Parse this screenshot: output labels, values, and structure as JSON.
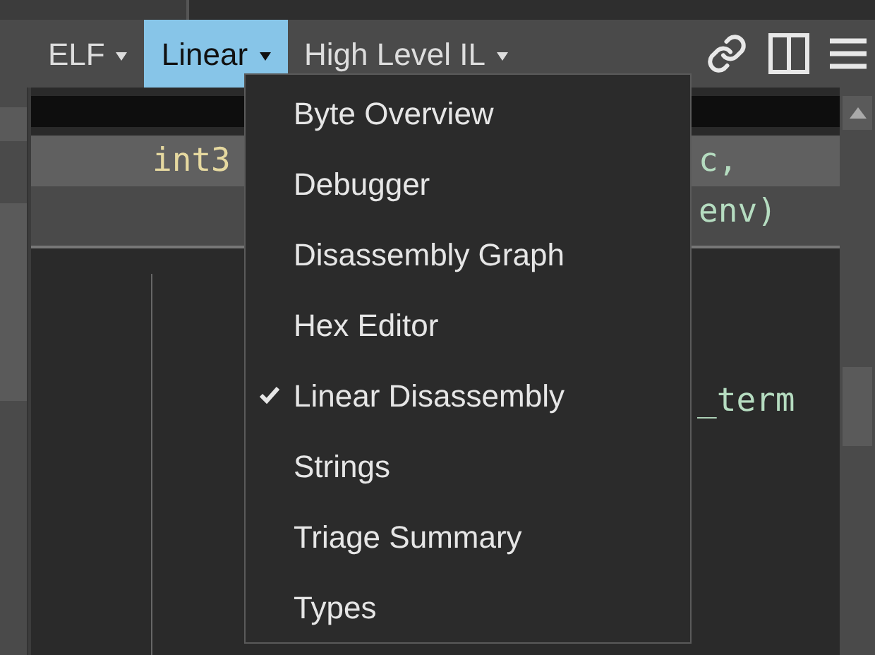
{
  "toolbar": {
    "tabs": [
      {
        "label": "ELF",
        "selected": false
      },
      {
        "label": "Linear",
        "selected": true
      },
      {
        "label": "High Level IL",
        "selected": false
      }
    ]
  },
  "code": {
    "header_lines": [
      {
        "left": "int3",
        "right": "c,",
        "highlighted": true
      },
      {
        "right": "env)",
        "highlighted": false
      }
    ],
    "body_lines": [
      {
        "right": "_term"
      }
    ]
  },
  "menu": {
    "items": [
      {
        "label": "Byte Overview",
        "checked": false
      },
      {
        "label": "Debugger",
        "checked": false
      },
      {
        "label": "Disassembly Graph",
        "checked": false
      },
      {
        "label": "Hex Editor",
        "checked": false
      },
      {
        "label": "Linear Disassembly",
        "checked": true
      },
      {
        "label": "Strings",
        "checked": false
      },
      {
        "label": "Triage Summary",
        "checked": false
      },
      {
        "label": "Types",
        "checked": false
      }
    ]
  }
}
